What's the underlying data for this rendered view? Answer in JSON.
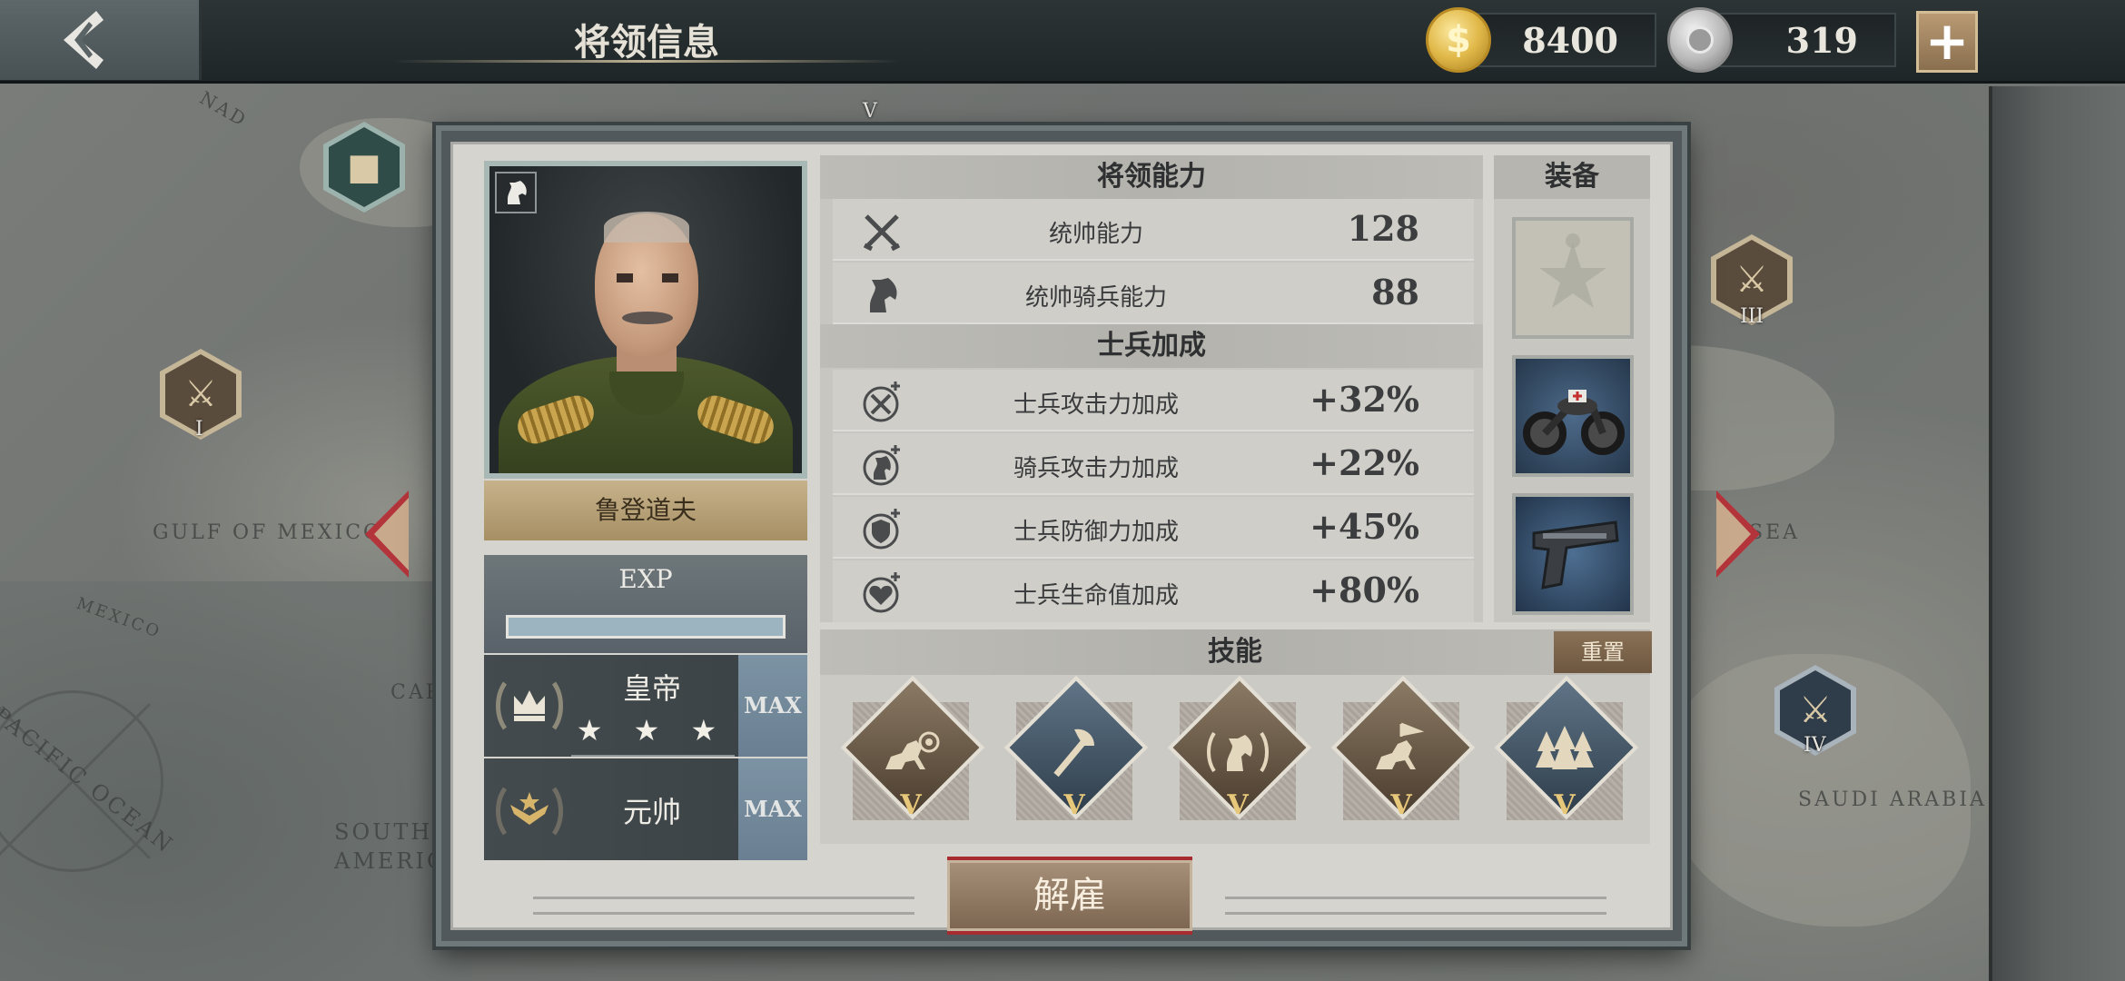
{
  "header": {
    "title": "将领信息",
    "gold_amount": "8400",
    "medal_amount": "319",
    "plus_label": "+"
  },
  "map": {
    "labels": [
      "GULF OF MEXICO",
      "MEXICO",
      "PACIFIC OCEAN",
      "SOUTH AMERICA",
      "SAUDI ARABIA",
      "SEA",
      "CAR",
      "NAD"
    ],
    "nodes": [
      "I",
      "III",
      "IV",
      "V"
    ]
  },
  "general": {
    "name": "鲁登道夫",
    "type_icon": "knight-icon",
    "exp_label": "EXP",
    "exp_progress": 1.0,
    "rank1_name": "皇帝",
    "rank1_stars": "★ ★ ★",
    "rank1_max": "MAX",
    "rank2_name": "元帅",
    "rank2_max": "MAX"
  },
  "abilities": {
    "title": "将领能力",
    "items": [
      {
        "icon": "crossed-swords-icon",
        "label": "统帅能力",
        "value": "128"
      },
      {
        "icon": "knight-icon",
        "label": "统帅骑兵能力",
        "value": "88"
      }
    ]
  },
  "bonuses": {
    "title": "士兵加成",
    "items": [
      {
        "icon": "sword-plus-icon",
        "label": "士兵攻击力加成",
        "value": "+32%"
      },
      {
        "icon": "knight-plus-icon",
        "label": "骑兵攻击力加成",
        "value": "+22%"
      },
      {
        "icon": "shield-plus-icon",
        "label": "士兵防御力加成",
        "value": "+45%"
      },
      {
        "icon": "heart-plus-icon",
        "label": "士兵生命值加成",
        "value": "+80%"
      }
    ]
  },
  "equipment": {
    "title": "装备",
    "slots": [
      "medal-icon",
      "motorcycle-icon",
      "pistol-icon"
    ]
  },
  "skills": {
    "title": "技能",
    "reset_label": "重置",
    "items": [
      {
        "icon": "cavalry-charge-icon",
        "tier": "V",
        "color": "#6b5b48"
      },
      {
        "icon": "axe-icon",
        "tier": "V",
        "color": "#3f5061"
      },
      {
        "icon": "horse-laurel-icon",
        "tier": "V",
        "color": "#6b5b48"
      },
      {
        "icon": "cavalry-charge-icon",
        "tier": "V",
        "color": "#6b5b48"
      },
      {
        "icon": "forest-icon",
        "tier": "V",
        "color": "#3f5061"
      }
    ]
  },
  "footer": {
    "dismiss_label": "解雇"
  },
  "colors": {
    "accent_red": "#b3343a",
    "gold": "#e7c77a"
  }
}
